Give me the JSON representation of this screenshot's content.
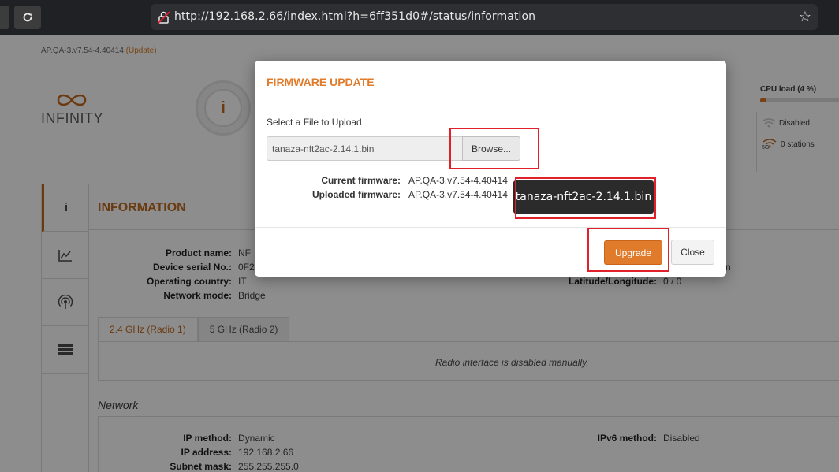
{
  "browser": {
    "url": "http://192.168.2.66/index.html?h=6ff351d0#/status/information"
  },
  "header": {
    "version": "AP.QA-3.v7.54-4.40414",
    "update_link": "(Update)",
    "logo_text": "INFINITY"
  },
  "status": {
    "cpu_label": "CPU load (4 %)",
    "cpu_percent": 4,
    "wifi_24_status": "Disabled",
    "wifi_5_badge": "5G",
    "wifi_5_status": "0 stations"
  },
  "section": {
    "title": "INFORMATION",
    "info_icon": "i"
  },
  "info": {
    "product_name_label": "Product name:",
    "product_name_value": "NF",
    "serial_label": "Device serial No.:",
    "serial_value": "0F2",
    "country_label": "Operating country:",
    "country_value": "IT",
    "mode_label": "Network mode:",
    "mode_value": "Bridge",
    "latlng_label": "Latitude/Longitude:",
    "latlng_value": "0 / 0",
    "right_partial_value": "n"
  },
  "radio_tabs": [
    {
      "label": "2.4 GHz (Radio 1)",
      "active": true
    },
    {
      "label": "5 GHz (Radio 2)",
      "active": false
    }
  ],
  "radio_message": "Radio interface is disabled manually.",
  "network": {
    "title": "Network",
    "ip_method_label": "IP method:",
    "ip_method_value": "Dynamic",
    "ip_address_label": "IP address:",
    "ip_address_value": "192.168.2.66",
    "subnet_label": "Subnet mask:",
    "subnet_value": "255.255.255.0",
    "ipv6_label": "IPv6 method:",
    "ipv6_value": "Disabled"
  },
  "modal": {
    "title": "FIRMWARE UPDATE",
    "select_label": "Select a File to Upload",
    "file_value": "tanaza-nft2ac-2.14.1.bin",
    "browse_label": "Browse...",
    "current_fw_label": "Current firmware:",
    "current_fw_value": "AP.QA-3.v7.54-4.40414",
    "uploaded_fw_label": "Uploaded firmware:",
    "uploaded_fw_value": "AP.QA-3.v7.54-4.40414",
    "upgrade_label": "Upgrade",
    "close_label": "Close"
  },
  "tooltip": {
    "text": "tanaza-nft2ac-2.14.1.bin"
  },
  "colors": {
    "accent": "#e07b2b",
    "highlight": "#e0202a"
  }
}
